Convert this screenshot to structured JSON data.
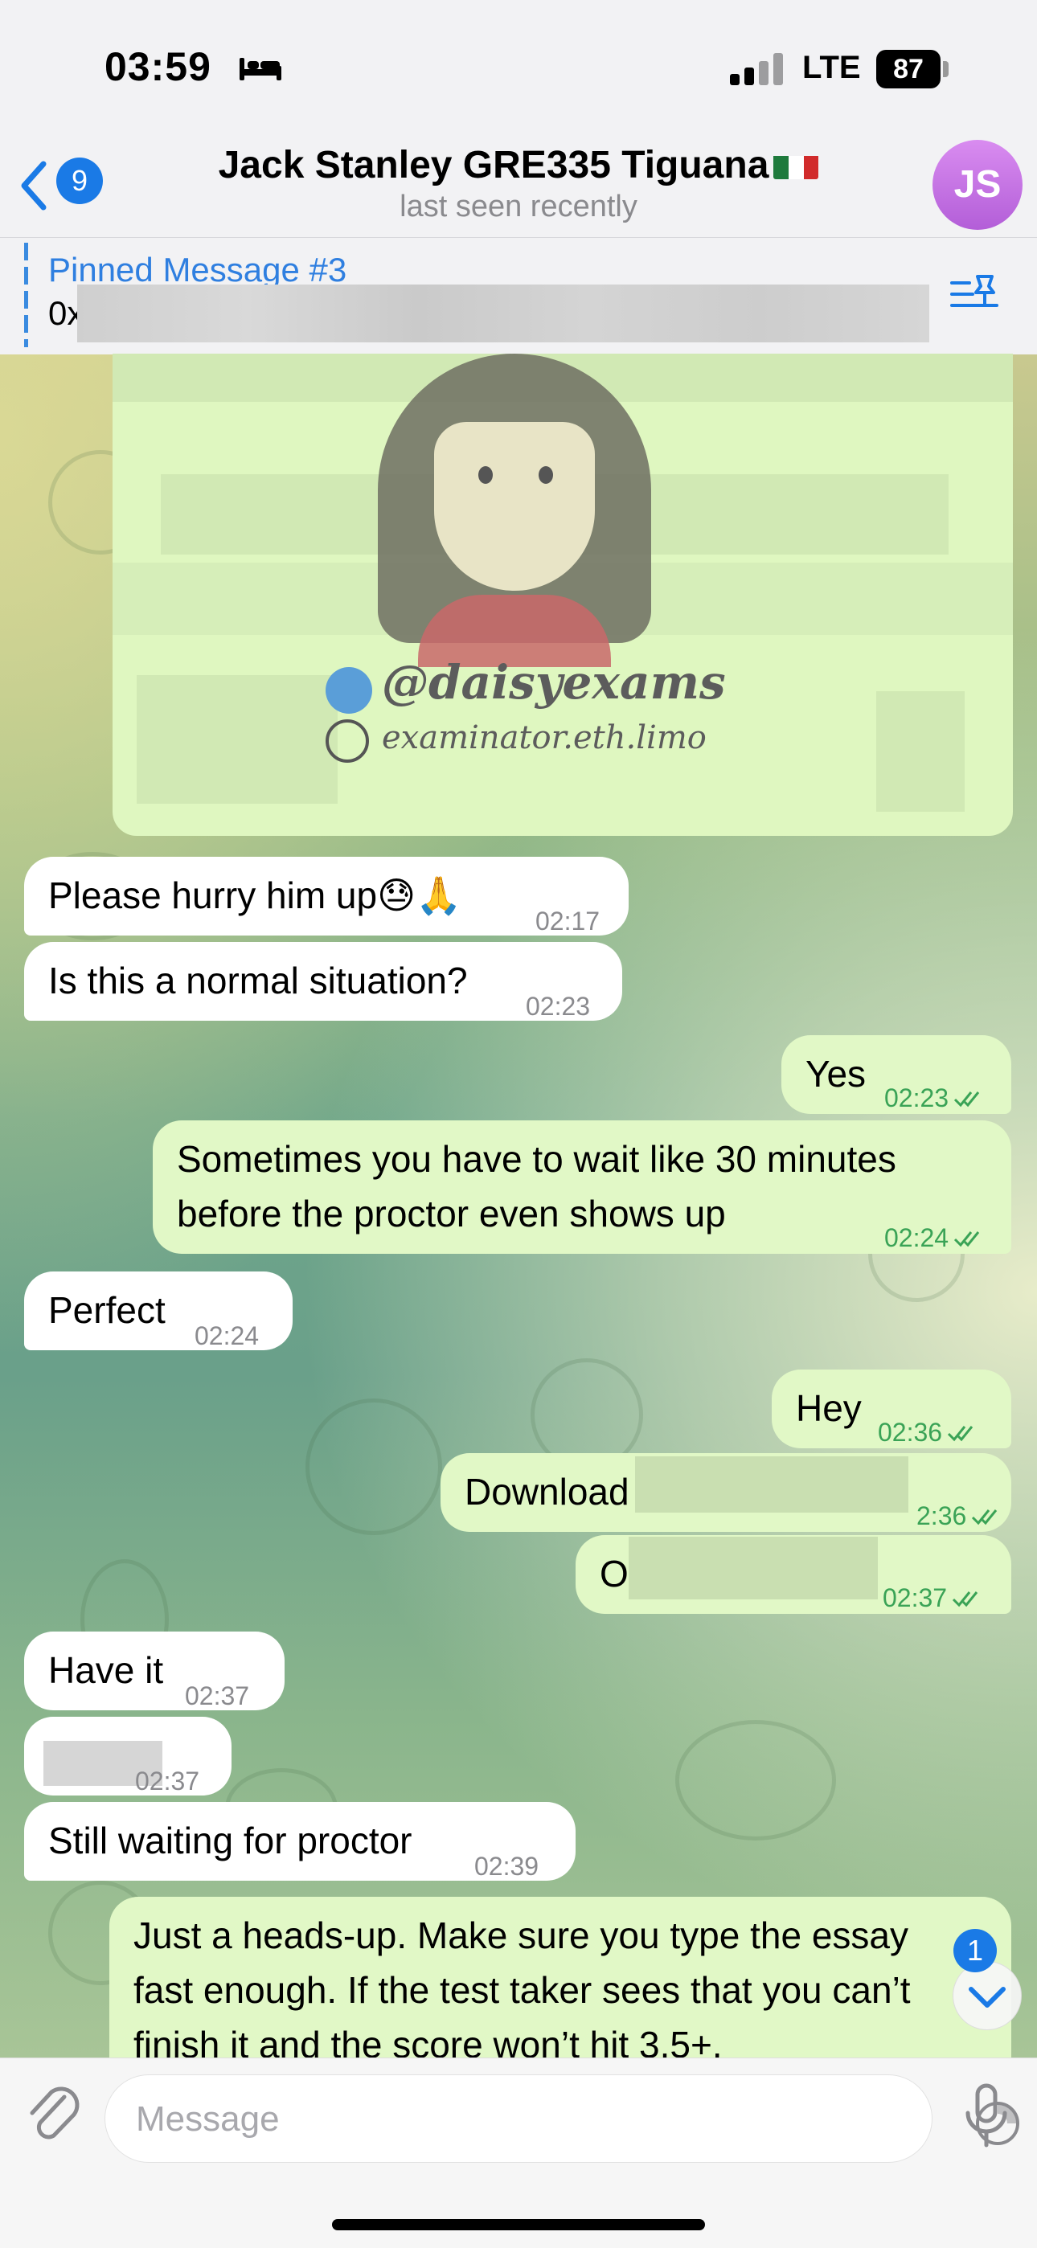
{
  "status_bar": {
    "time": "03:59",
    "network": "LTE",
    "battery": "87"
  },
  "header": {
    "back_badge": "9",
    "title": "Jack Stanley GRE335 Tiguana",
    "subtitle": "last seen recently",
    "avatar_initials": "JS",
    "flag_icon": "mexico-flag"
  },
  "pinned": {
    "title": "Pinned Message #3",
    "text": "0x"
  },
  "image_message": {
    "handle": "@daisyexams",
    "site": "examinator.eth.limo"
  },
  "messages": [
    {
      "dir": "in",
      "text": "Please hurry him up😓🙏",
      "time": "02:17"
    },
    {
      "dir": "in",
      "text": "Is this a normal situation?",
      "time": "02:23"
    },
    {
      "dir": "out",
      "text": "Yes",
      "time": "02:23"
    },
    {
      "dir": "out",
      "text": "Sometimes you have to wait like 30 minutes before the proctor even shows up",
      "time": "02:24"
    },
    {
      "dir": "in",
      "text": "Perfect",
      "time": "02:24"
    },
    {
      "dir": "out",
      "text": "Hey",
      "time": "02:36"
    },
    {
      "dir": "out",
      "text": "Download",
      "time": "2:36"
    },
    {
      "dir": "out",
      "text": "O",
      "time": "02:37"
    },
    {
      "dir": "in",
      "text": "Have it",
      "time": "02:37"
    },
    {
      "dir": "in",
      "text": "",
      "time": "02:37"
    },
    {
      "dir": "in",
      "text": "Still waiting for proctor",
      "time": "02:39"
    },
    {
      "dir": "out",
      "text": "Just a heads-up. Make sure you type the essay fast enough. If the test taker sees that you can’t finish it and the score won’t hit 3.5+,",
      "time": ""
    }
  ],
  "scroll_badge": "1",
  "input": {
    "placeholder": "Message"
  },
  "colors": {
    "accent": "#1a7ae6",
    "outgoing_bubble": "#e1f8c6",
    "incoming_bubble": "#ffffff",
    "read_check": "#3aa356"
  }
}
